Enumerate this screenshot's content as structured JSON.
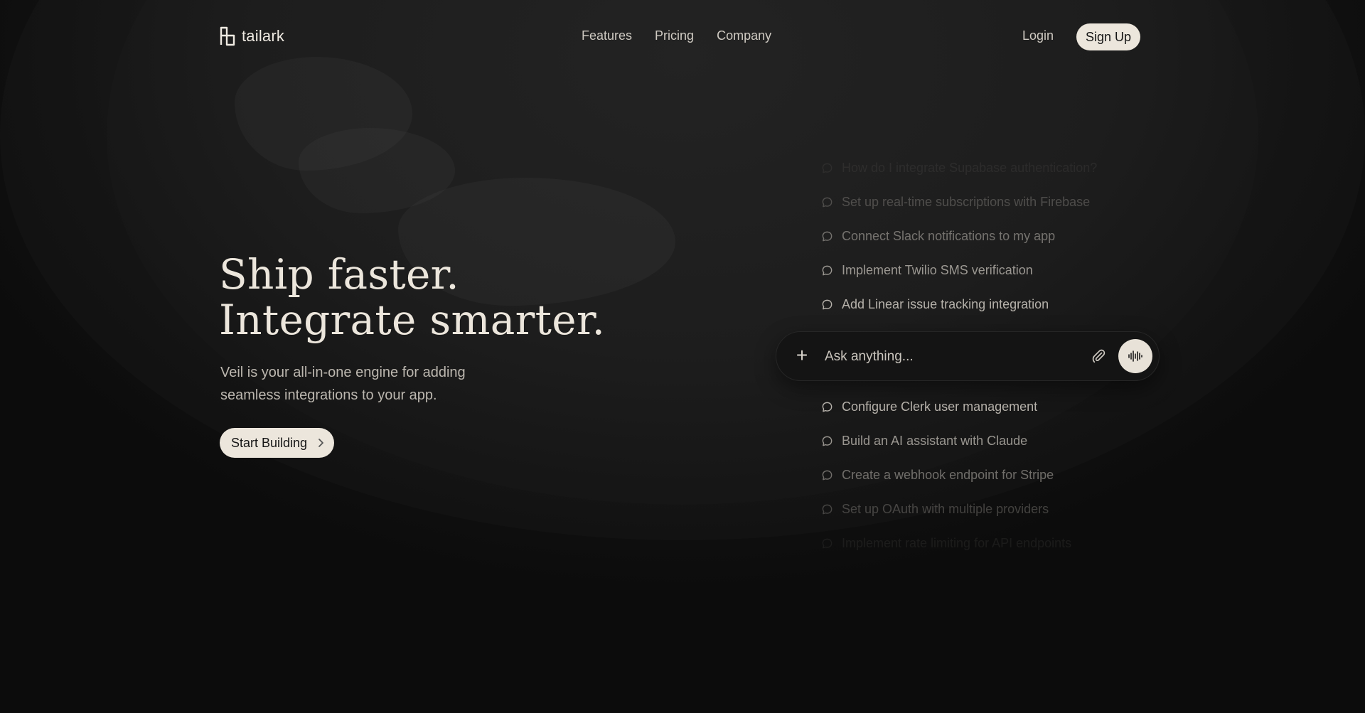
{
  "brand": {
    "name": "tailark"
  },
  "nav": {
    "links": [
      "Features",
      "Pricing",
      "Company"
    ],
    "login": "Login",
    "signup": "Sign Up"
  },
  "hero": {
    "title_line1": "Ship faster.",
    "title_line2": "Integrate smarter.",
    "subtitle": "Veil is your all-in-one engine for adding seamless integrations to your app.",
    "cta": "Start Building"
  },
  "suggestions_above": [
    "How do I integrate Supabase authentication?",
    "Set up real-time subscriptions with Firebase",
    "Connect Slack notifications to my app",
    "Implement Twilio SMS verification",
    "Add Linear issue tracking integration"
  ],
  "ask": {
    "placeholder": "Ask anything..."
  },
  "suggestions_below": [
    "Configure Clerk user management",
    "Build an AI assistant with Claude",
    "Create a webhook endpoint for Stripe",
    "Set up OAuth with multiple providers",
    "Implement rate limiting for API endpoints"
  ],
  "colors": {
    "background": "#0d0d0d",
    "accent_pill": "#ece6dc",
    "text_primary": "#ece6dc",
    "text_muted": "#bcb7af"
  }
}
